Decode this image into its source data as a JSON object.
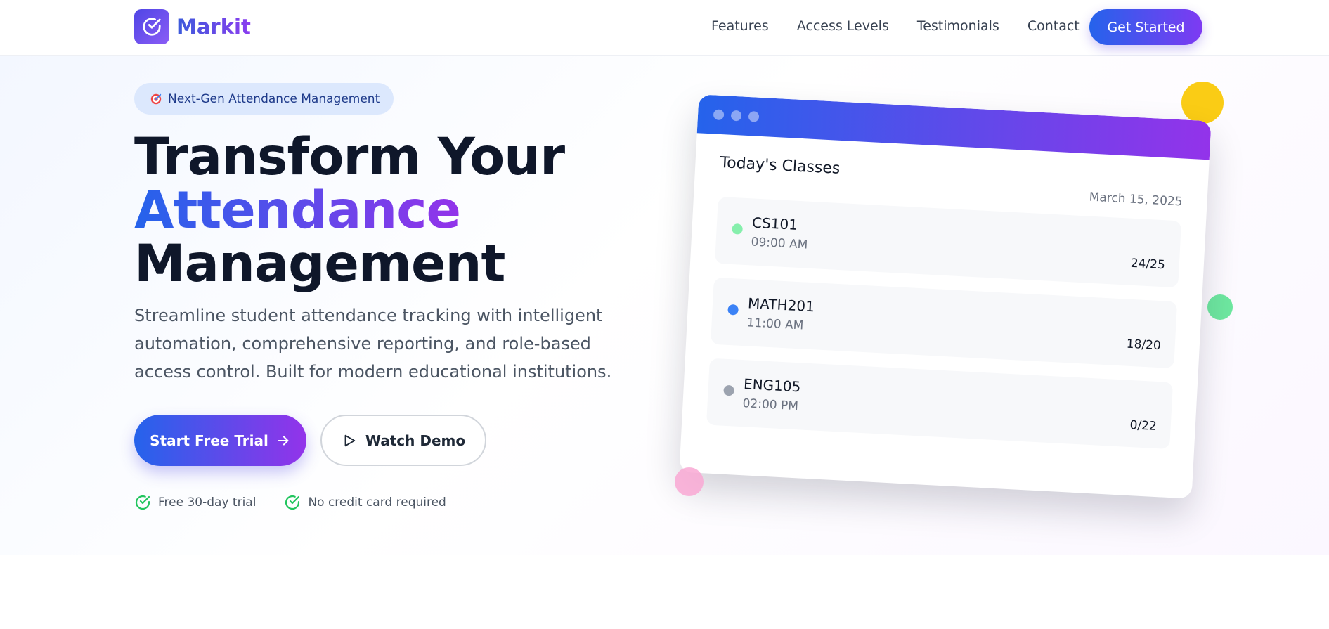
{
  "nav": {
    "logo_text": "Markit",
    "links": [
      "Features",
      "Access Levels",
      "Testimonials",
      "Contact"
    ],
    "cta_label": "Get Started"
  },
  "hero": {
    "badge_text": "Next-Gen Attendance Management",
    "title_line1": "Transform Your",
    "title_line2": "Attendance",
    "title_line3": "Management",
    "description": "Streamline student attendance tracking with intelligent automation, comprehensive reporting, and role-based access control. Built for modern educational institutions.",
    "primary_button": "Start Free Trial",
    "secondary_button": "Watch Demo",
    "perks": [
      "Free 30-day trial",
      "No credit card required"
    ]
  },
  "preview": {
    "title": "Today's Classes",
    "date": "March 15, 2025",
    "classes": [
      {
        "code": "CS101",
        "time": "09:00 AM",
        "count": "24/25",
        "status_color": "#86efac"
      },
      {
        "code": "MATH201",
        "time": "11:00 AM",
        "count": "18/20",
        "status_color": "#3b82f6"
      },
      {
        "code": "ENG105",
        "time": "02:00 PM",
        "count": "0/22",
        "status_color": "#9ca3af"
      }
    ]
  },
  "colors": {
    "accent_blue": "#2563eb",
    "accent_purple": "#9333ea",
    "check_green": "#22c55e",
    "blob_yellow": "#facc15",
    "blob_green": "#6ee7a0",
    "blob_pink": "#f9a8d4"
  },
  "icons": {
    "logo": "check-circle-icon",
    "badge": "target-icon",
    "primary_button": "arrow-right-icon",
    "secondary_button": "play-icon",
    "perks": "check-circle-icon"
  }
}
